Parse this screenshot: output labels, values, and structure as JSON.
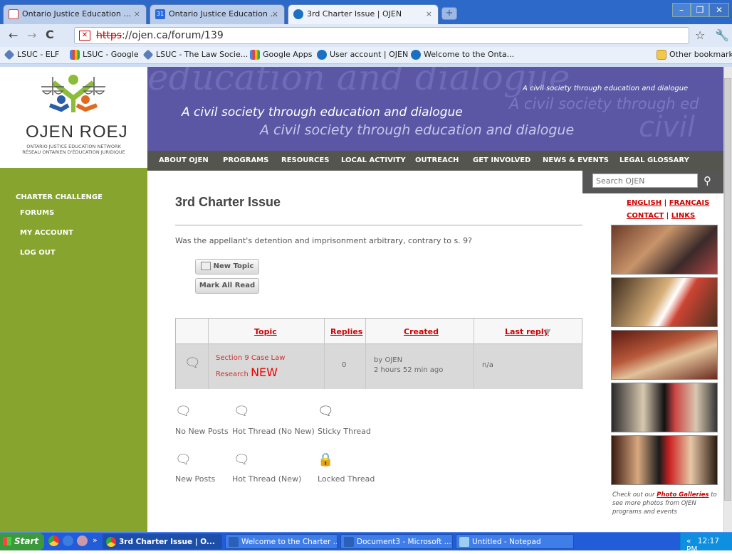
{
  "browser": {
    "tabs": [
      {
        "label": "Ontario Justice Education ...",
        "icon": "gmail-icon",
        "color": "#d33"
      },
      {
        "label": "Ontario Justice Education ...",
        "icon": "calendar-icon",
        "color": "#2a6ad8"
      },
      {
        "label": "3rd Charter Issue | OJEN",
        "icon": "drupal-icon",
        "color": "#1c70c2"
      }
    ],
    "url_scheme": "https",
    "url_rest": "://ojen.ca/forum/139",
    "bookmarks": [
      "LSUC - ELF",
      "LSUC - Google",
      "LSUC - The Law Socie...",
      "Google Apps",
      "User account | OJEN",
      "Welcome to the Onta..."
    ],
    "other_bookmarks": "Other bookmarks"
  },
  "site": {
    "org_name": "OJEN ROEJ",
    "org_line1": "ONTARIO JUSTICE EDUCATION NETWORK",
    "org_line2": "RÉSEAU ONTARIEN D'ÉDUCATION JURIDIQUE",
    "banner_big": "education and dialogue",
    "banner_line1": "A civil society through education and dialogue",
    "banner_line2": "A civil society through education and dialogue",
    "banner_small": "A civil society through education and dialogue",
    "banner_ghost": "A civil society through ed",
    "banner_soc": "civil soc",
    "nav": [
      "ABOUT OJEN",
      "PROGRAMS",
      "RESOURCES",
      "LOCAL ACTIVITY",
      "OUTREACH",
      "GET INVOLVED",
      "NEWS & EVENTS",
      "LEGAL GLOSSARY"
    ],
    "search_placeholder": "Search OJEN"
  },
  "sidebar": {
    "heading": "CHARTER CHALLENGE",
    "items": [
      "FORUMS",
      "MY ACCOUNT",
      "LOG OUT"
    ]
  },
  "content": {
    "title": "3rd Charter Issue",
    "description": "Was the appellant's detention and imprisonment arbitrary, contrary to s. 9?",
    "new_topic": "New Topic",
    "mark_all_read": "Mark All Read",
    "table": {
      "headers": [
        "Topic",
        "Replies",
        "Created",
        "Last reply"
      ],
      "rows": [
        {
          "topic1": "Section 9 Case Law",
          "topic2": "Research",
          "badge": "NEW",
          "replies": "0",
          "created_by": "by OJEN",
          "created_ago": "2 hours 52 min ago",
          "last_reply": "n/a"
        }
      ]
    },
    "legend": [
      "No New Posts",
      "Hot Thread (No New)",
      "Sticky Thread",
      "New Posts",
      "Hot Thread (New)",
      "Locked Thread"
    ]
  },
  "rightcol": {
    "english": "ENGLISH",
    "francais": "FRANÇAIS",
    "contact": "CONTACT",
    "links": "LINKS",
    "sep": "|",
    "caption_pre": "Check out our",
    "caption_link": "Photo Galleries",
    "caption_post": "to see more photos from OJEN programs and events"
  },
  "taskbar": {
    "start": "Start",
    "chevron": "»",
    "tasks": [
      "3rd Charter Issue | O...",
      "Welcome to the Charter ...",
      "Document3 - Microsoft ...",
      "Untitled - Notepad"
    ],
    "tray_chevron": "«",
    "time": "12:17 PM"
  },
  "colors": {
    "banner": "#5b57a5",
    "sidebar": "#87a52e",
    "accent_red": "#cc0000",
    "nav": "#55554f"
  }
}
